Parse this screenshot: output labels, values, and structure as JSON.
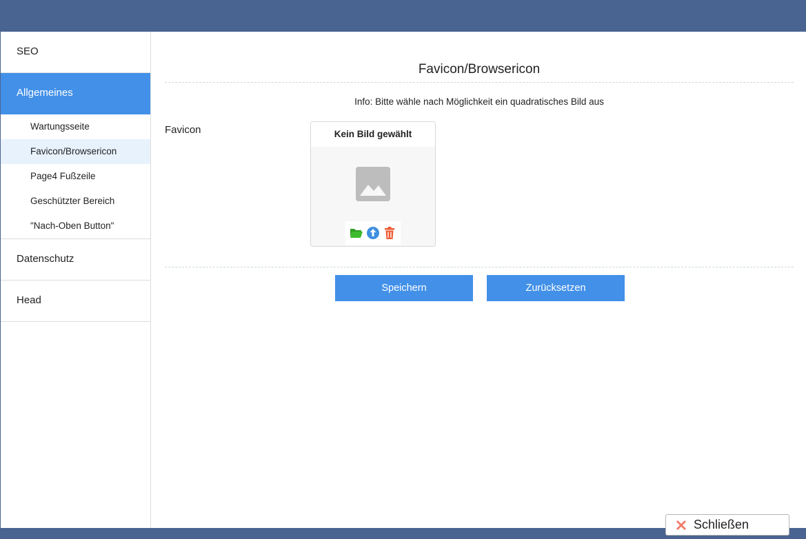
{
  "sidebar": {
    "items": [
      {
        "label": "SEO"
      },
      {
        "label": "Allgemeines"
      },
      {
        "label": "Datenschutz"
      },
      {
        "label": "Head"
      }
    ],
    "subitems": [
      {
        "label": "Wartungsseite"
      },
      {
        "label": "Favicon/Browsericon"
      },
      {
        "label": "Page4 Fußzeile"
      },
      {
        "label": "Geschützter Bereich"
      },
      {
        "label": "\"Nach-Oben Button\""
      }
    ]
  },
  "main": {
    "title": "Favicon/Browsericon",
    "info": "Info: Bitte wähle nach Möglichkeit ein quadratisches Bild aus",
    "field_label": "Favicon",
    "image_box": {
      "header": "Kein Bild gewählt",
      "placeholder_icon": "image-placeholder-icon",
      "actions": [
        "folder-open-icon",
        "upload-icon",
        "trash-icon"
      ]
    },
    "save_label": "Speichern",
    "reset_label": "Zurücksetzen"
  },
  "footer": {
    "close_label": "Schließen"
  },
  "colors": {
    "frame": "#4a6491",
    "accent": "#4290e8",
    "active_sub_bg": "#e7f2fd",
    "folder": "#3dba2e",
    "upload": "#3d8fe0",
    "trash": "#ee5b32",
    "close_x": "#f27b6a"
  }
}
